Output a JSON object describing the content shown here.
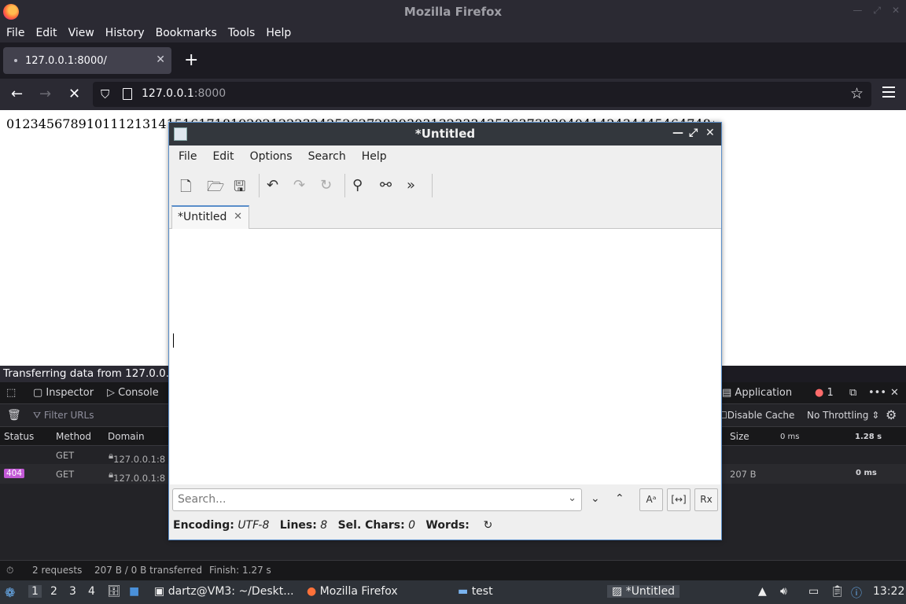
{
  "firefox": {
    "window_title": "Mozilla Firefox",
    "menu": [
      "File",
      "Edit",
      "View",
      "History",
      "Bookmarks",
      "Tools",
      "Help"
    ],
    "tab_title": "127.0.0.1:8000/",
    "url_host": "127.0.0.1",
    "url_port": ":8000",
    "content_text": "012345678910111213141516171819202122232425262728293031323334353637383940414243444546474849",
    "status_text": "Transferring data from 127.0.0.1…"
  },
  "devtools": {
    "tools": [
      "Inspector",
      "Console",
      "Application"
    ],
    "error_count": "1",
    "filter_placeholder": "Filter URLs",
    "disable_cache": "Disable Cache",
    "throttling": "No Throttling ⇕",
    "columns": [
      "Status",
      "Method",
      "Domain",
      "Size"
    ],
    "timeline_labels": [
      "0 ms",
      "1.28 s"
    ],
    "rows": [
      {
        "status": "",
        "method": "GET",
        "domain": "127.0.0.1:8",
        "size": "",
        "time": ""
      },
      {
        "status": "404",
        "method": "GET",
        "domain": "127.0.0.1:8",
        "size": "207 B",
        "time": "0 ms"
      }
    ],
    "summary": {
      "requests": "2 requests",
      "transferred": "207 B / 0 B transferred",
      "finish": "Finish: 1.27 s"
    }
  },
  "featherpad": {
    "title": "*Untitled",
    "menu": [
      "File",
      "Edit",
      "Options",
      "Search",
      "Help"
    ],
    "tab": "*Untitled",
    "search_placeholder": "Search...",
    "btn_case": "Aᵃ",
    "btn_whole": "[↔]",
    "btn_regex": "Rx",
    "status": {
      "encoding_label": "Encoding:",
      "encoding_value": "UTF-8",
      "lines_label": "Lines:",
      "lines_value": "8",
      "sel_label": "Sel. Chars:",
      "sel_value": "0",
      "words_label": "Words:"
    }
  },
  "taskbar": {
    "workspaces": [
      "1",
      "2",
      "3",
      "4"
    ],
    "tasks": [
      "dartz@VM3: ~/Deskt...",
      "Mozilla Firefox",
      "test",
      "*Untitled"
    ],
    "clock": "13:22"
  }
}
